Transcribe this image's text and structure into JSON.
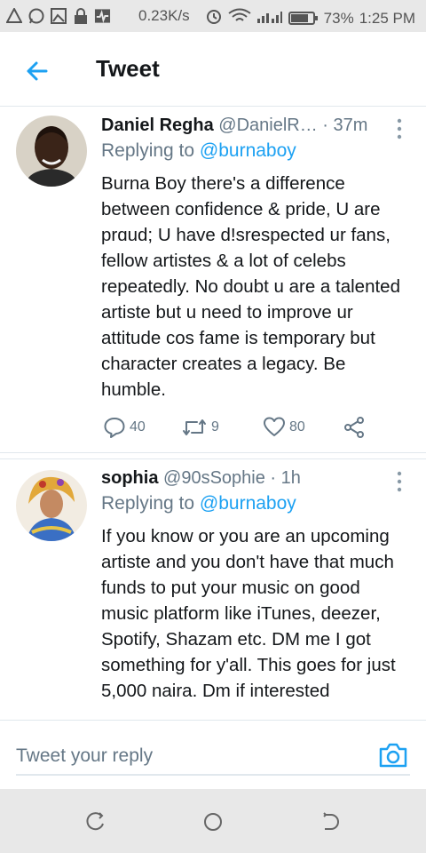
{
  "status_bar": {
    "left_icons": [
      "warning-icon",
      "whatsapp-icon",
      "gallery-icon",
      "lock-icon",
      "pulse-icon"
    ],
    "speed": "0.23K/s",
    "battery_percent": "73%",
    "battery_level": 0.73,
    "time": "1:25 PM"
  },
  "header": {
    "back_icon": "arrow-left-icon",
    "title": "Tweet"
  },
  "tweets": [
    {
      "name": "Daniel Regha",
      "handle": "@DanielR…",
      "time": "· 37m",
      "replying_prefix": "Replying to",
      "replying_to": "@burnaboy",
      "text": "Burna Boy there's a difference between confidence & pride, U are prɑud; U have d!srespected ur fans, fellow artistes & a lot of celebs repeatedly. No doubt u are a talented artiste but u need to improve ur attitude cos fame is temporary but character creates a legacy. Be humble.",
      "reply_count": "40",
      "retweet_count": "9",
      "like_count": "80"
    },
    {
      "name": "sophia",
      "handle": "@90sSophie",
      "time": "· 1h",
      "replying_prefix": "Replying to",
      "replying_to": "@burnaboy",
      "text": "If you know or you are an upcoming artiste and you don't have that much funds to put your music on good music platform like iTunes, deezer, Spotify, Shazam etc. DM me  I  got something for y'all. This goes for just 5,000 naira. Dm if interested"
    }
  ],
  "reply_bar": {
    "placeholder": "Tweet your reply",
    "camera_icon": "camera-icon"
  },
  "nav_bar": {
    "icons": [
      "recent-apps-icon",
      "home-icon",
      "back-icon"
    ]
  },
  "colors": {
    "accent": "#1da1f2",
    "secondary_text": "#657786",
    "primary_text": "#14171a",
    "divider": "#e1e8ed",
    "system_bar": "#e8e8e8"
  }
}
